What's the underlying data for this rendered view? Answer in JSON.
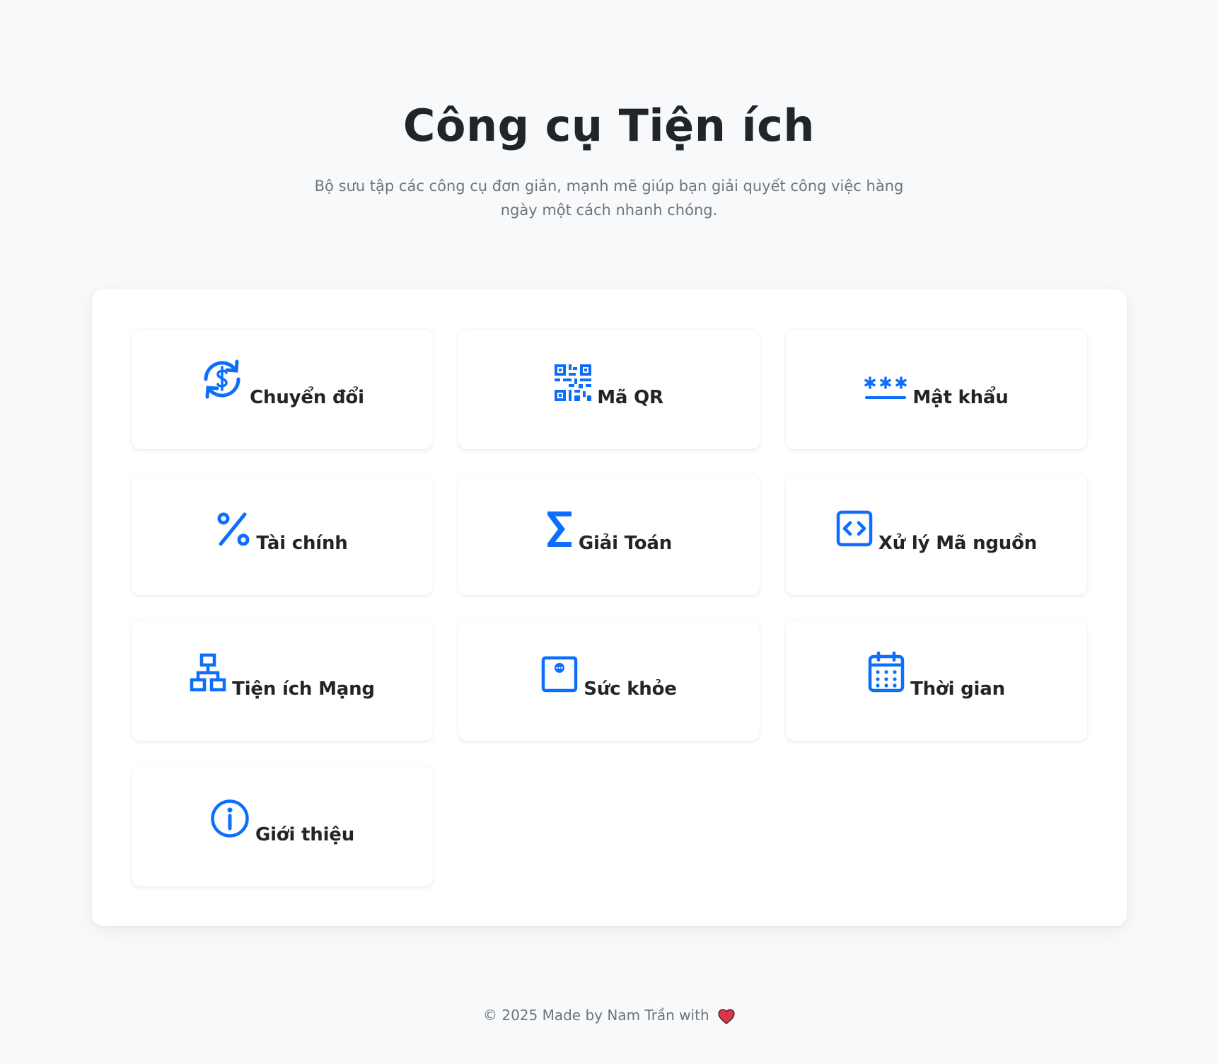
{
  "header": {
    "title": "Công cụ Tiện ích",
    "subtitle": "Bộ sưu tập các công cụ đơn giản, mạnh mẽ giúp bạn giải quyết công việc hàng ngày một cách nhanh chóng."
  },
  "tools": [
    {
      "label": "Chuyển đổi",
      "icon": "currency-exchange-icon"
    },
    {
      "label": "Mã QR",
      "icon": "qr-code-icon"
    },
    {
      "label": "Mật khẩu",
      "icon": "password-icon"
    },
    {
      "label": "Tài chính",
      "icon": "percent-icon"
    },
    {
      "label": "Giải Toán",
      "icon": "sigma-icon"
    },
    {
      "label": "Xử lý Mã nguồn",
      "icon": "code-square-icon"
    },
    {
      "label": "Tiện ích Mạng",
      "icon": "diagram-network-icon"
    },
    {
      "label": "Sức khỏe",
      "icon": "health-device-icon"
    },
    {
      "label": "Thời gian",
      "icon": "calendar-icon"
    },
    {
      "label": "Giới thiệu",
      "icon": "info-circle-icon"
    }
  ],
  "footer": {
    "text": "© 2025 Made by Nam Trần with",
    "heart_icon": "heart-icon"
  },
  "colors": {
    "accent": "#0d6efd",
    "background": "#f8f9fa",
    "heart": "#dc3545"
  }
}
